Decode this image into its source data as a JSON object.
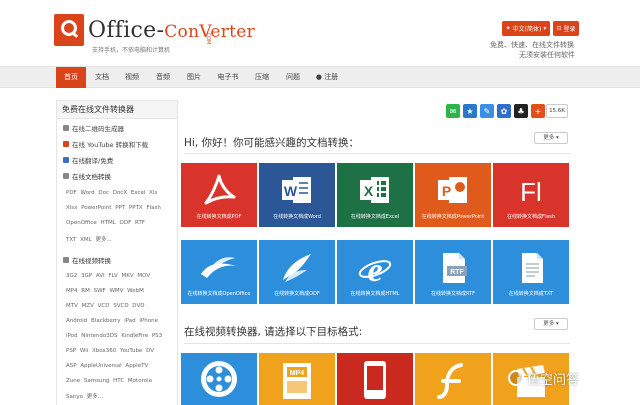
{
  "header": {
    "logo_name_1": "Office-",
    "logo_name_2": "ConVerter",
    "logo_com": ".COM",
    "tagline": "支持手机，不依电脑和计算机",
    "lang_button": "中文(简体)",
    "login_button": "登录",
    "slogan_1": "免费、快速、在线文件转换",
    "slogan_2": "无须安装任何软件"
  },
  "nav": [
    "首页",
    "文档",
    "视频",
    "音频",
    "图片",
    "电子书",
    "压缩",
    "问题",
    "注册"
  ],
  "sidebar": {
    "title": "免费在线文件转换器",
    "links": [
      "在线二维码生成器",
      "在线 YouTube 转换和下载",
      "在线翻译/免费",
      "在线文档转换"
    ],
    "doc_formats": [
      "PDF  Word  Doc  DocX  Excel  Xls",
      "Xlsx  PowerPoint  PPT  PPTX  Flash",
      "OpenOffice  HTML  ODF  RTF",
      "TXT  XML  更多..."
    ],
    "video_section": "在线视频转换",
    "video_formats": [
      "3G2  3GP  AVI  FLV  MKV  MOV",
      "MP4  RM  SWF  WMV  WebM",
      "MTV  MZV  VCD  SVCD  DVD",
      "Android  Blackberry  iPad  iPhone",
      "iPod  Nintendo3DS  KindleFire  PS3",
      "PSP  Wii  Xbox360  YouTube  DV",
      "ASP  AppleUniversal  AppleTV",
      "Zune  Samsung  HTC  Motorola",
      "Sanyo  更多..."
    ]
  },
  "social": {
    "count": "15.6K",
    "colors": [
      "#2fb34b",
      "#2a78c6",
      "#3a8ee6",
      "#2f6fc7",
      "#222222",
      "#e0501c"
    ]
  },
  "doc_section": {
    "title": "Hi, 你好！你可能感兴趣的文档转换：",
    "more": "更多 ▾",
    "tiles": [
      {
        "caption": "在线转换文档成PDF",
        "color": "#d9342b",
        "icon": "pdf-icon"
      },
      {
        "caption": "在线转换文档成Word",
        "color": "#2b5797",
        "icon": "word-icon"
      },
      {
        "caption": "在线转换文档成Excel",
        "color": "#1e7145",
        "icon": "excel-icon"
      },
      {
        "caption": "在线转换文档成PowerPoint",
        "color": "#e05a1c",
        "icon": "powerpoint-icon"
      },
      {
        "caption": "在线转换文档成Flash",
        "color": "#d9342b",
        "icon": "flash-icon"
      },
      {
        "caption": "在线转换文档成OpenOffice",
        "color": "#2d8fdc",
        "icon": "openoffice-icon"
      },
      {
        "caption": "在线转换文档成ODF",
        "color": "#2d8fdc",
        "icon": "odf-icon"
      },
      {
        "caption": "在线转换文档成HTML",
        "color": "#2d8fdc",
        "icon": "html-icon"
      },
      {
        "caption": "在线转换文档成RTF",
        "color": "#2d8fdc",
        "icon": "rtf-icon"
      },
      {
        "caption": "在线转换文档成TXT",
        "color": "#2d8fdc",
        "icon": "txt-icon"
      }
    ]
  },
  "video_section": {
    "title": "在线视频转换器, 请选择以下目标格式:",
    "more": "更多 ▾",
    "tiles": [
      {
        "color": "#2d8fdc",
        "icon": "film-reel-icon"
      },
      {
        "color": "#f0a21c",
        "icon": "mp4-icon"
      },
      {
        "color": "#c9291f",
        "icon": "mobile-icon"
      },
      {
        "color": "#f0a21c",
        "icon": "flash-player-icon"
      },
      {
        "color": "#f0a21c",
        "icon": "clapper-icon"
      }
    ]
  },
  "watermark": "悟空问答"
}
